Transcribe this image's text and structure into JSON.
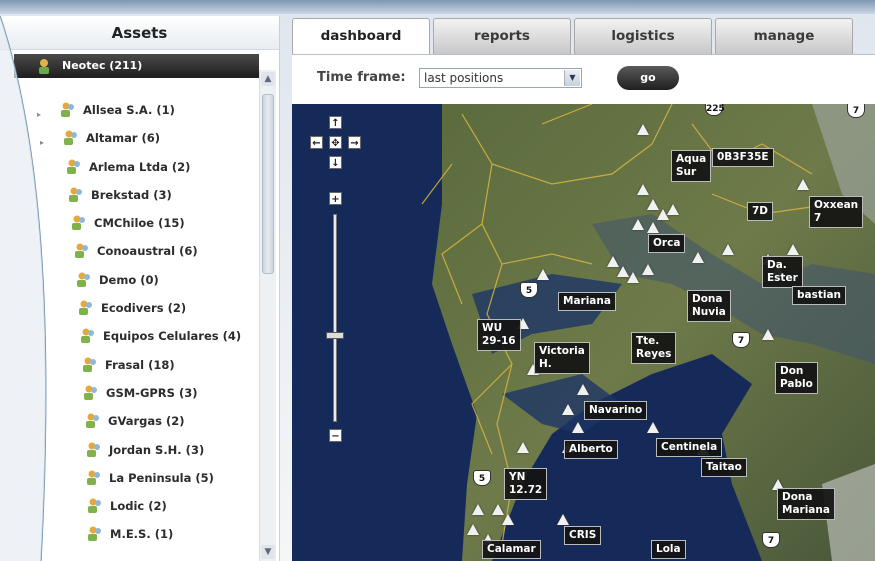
{
  "sidebar": {
    "title": "Assets",
    "root": {
      "label": "Neotec (211)"
    },
    "items": [
      {
        "label": "Allsea S.A. (1)"
      },
      {
        "label": "Altamar (6)"
      },
      {
        "label": "Arlema Ltda (2)"
      },
      {
        "label": "Brekstad (3)"
      },
      {
        "label": "CMChiloe (15)"
      },
      {
        "label": "Conoaustral (6)"
      },
      {
        "label": "Demo (0)"
      },
      {
        "label": "Ecodivers (2)"
      },
      {
        "label": "Equipos Celulares (4)"
      },
      {
        "label": "Frasal (18)"
      },
      {
        "label": "GSM-GPRS (3)"
      },
      {
        "label": "GVargas (2)"
      },
      {
        "label": "Jordan S.H. (3)"
      },
      {
        "label": "La Peninsula (5)"
      },
      {
        "label": "Lodic (2)"
      },
      {
        "label": "M.E.S. (1)"
      }
    ]
  },
  "tabs": [
    {
      "label": "dashboard",
      "active": true
    },
    {
      "label": "reports"
    },
    {
      "label": "logistics"
    },
    {
      "label": "manage"
    }
  ],
  "toolbar": {
    "time_frame_label": "Time frame:",
    "time_frame_value": "last positions",
    "go_label": "go"
  },
  "map": {
    "road_shields": [
      "225",
      "5",
      "5",
      "7",
      "7",
      "7"
    ],
    "vessels": [
      "Aqua\nSur",
      "0B3F35E",
      "7D",
      "Oxxean\n7",
      "Orca",
      "Da.\nEster",
      "bastian",
      "Mariana",
      "Dona\nNuvia",
      "WU\n29-16",
      "Victoria\nH.",
      "Tte.\nReyes",
      "Don\nPablo",
      "Navarino",
      "Centinela",
      "Taitao",
      "Alberto",
      "YN\n12.72",
      "Dona\nMariana",
      "CRIS",
      "Calamar",
      "Lola"
    ]
  }
}
